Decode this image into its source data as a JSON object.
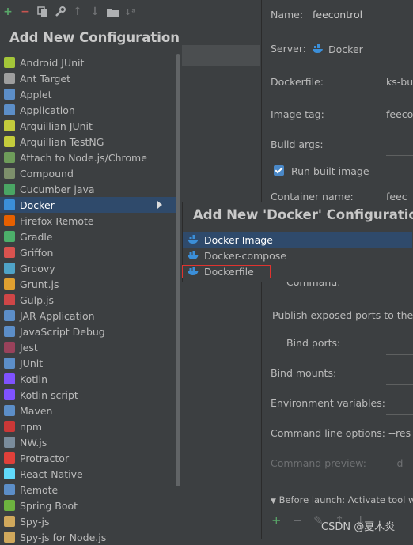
{
  "toolbar": {
    "icons": [
      "add-icon",
      "remove-icon",
      "copy-icon",
      "wrench-icon",
      "move-up-icon",
      "move-down-icon",
      "folder-icon",
      "sort-icon"
    ]
  },
  "left": {
    "title": "Add New Configuration",
    "items": [
      {
        "label": "Android JUnit",
        "icon": "android-junit-icon",
        "color": "#a4c639"
      },
      {
        "label": "Ant Target",
        "icon": "ant-icon",
        "color": "#9e9e9e"
      },
      {
        "label": "Applet",
        "icon": "applet-icon",
        "color": "#5c8ec8"
      },
      {
        "label": "Application",
        "icon": "application-icon",
        "color": "#5c8ec8"
      },
      {
        "label": "Arquillian JUnit",
        "icon": "arquillian-icon",
        "color": "#c4cc3c"
      },
      {
        "label": "Arquillian TestNG",
        "icon": "arquillian-icon",
        "color": "#c4cc3c"
      },
      {
        "label": "Attach to Node.js/Chrome",
        "icon": "nodejs-icon",
        "color": "#6e9c5a"
      },
      {
        "label": "Compound",
        "icon": "compound-icon",
        "color": "#7d8f6b"
      },
      {
        "label": "Cucumber java",
        "icon": "cucumber-icon",
        "color": "#4aa564"
      },
      {
        "label": "Docker",
        "icon": "docker-icon",
        "color": "#3b8fd9",
        "selected": true
      },
      {
        "label": "Firefox Remote",
        "icon": "firefox-icon",
        "color": "#e66000"
      },
      {
        "label": "Gradle",
        "icon": "gradle-icon",
        "color": "#4caf6a"
      },
      {
        "label": "Griffon",
        "icon": "griffon-icon",
        "color": "#d9534f"
      },
      {
        "label": "Groovy",
        "icon": "groovy-icon",
        "color": "#4fa3c7"
      },
      {
        "label": "Grunt.js",
        "icon": "grunt-icon",
        "color": "#e0a030"
      },
      {
        "label": "Gulp.js",
        "icon": "gulp-icon",
        "color": "#cf4647"
      },
      {
        "label": "JAR Application",
        "icon": "jar-icon",
        "color": "#5c8ec8"
      },
      {
        "label": "JavaScript Debug",
        "icon": "js-debug-icon",
        "color": "#5c8ec8"
      },
      {
        "label": "Jest",
        "icon": "jest-icon",
        "color": "#99425b"
      },
      {
        "label": "JUnit",
        "icon": "junit-icon",
        "color": "#5c8ec8"
      },
      {
        "label": "Kotlin",
        "icon": "kotlin-icon",
        "color": "#7f52ff"
      },
      {
        "label": "Kotlin script",
        "icon": "kotlin-script-icon",
        "color": "#7f52ff"
      },
      {
        "label": "Maven",
        "icon": "maven-icon",
        "color": "#5c8ec8"
      },
      {
        "label": "npm",
        "icon": "npm-icon",
        "color": "#cb3837"
      },
      {
        "label": "NW.js",
        "icon": "nwjs-icon",
        "color": "#7a8c9c"
      },
      {
        "label": "Protractor",
        "icon": "protractor-icon",
        "color": "#e0403a"
      },
      {
        "label": "React Native",
        "icon": "react-icon",
        "color": "#61dafb"
      },
      {
        "label": "Remote",
        "icon": "remote-icon",
        "color": "#5c8ec8"
      },
      {
        "label": "Spring Boot",
        "icon": "spring-icon",
        "color": "#6db33f"
      },
      {
        "label": "Spy-js",
        "icon": "spyjs-icon",
        "color": "#d0a85c"
      },
      {
        "label": "Spy-js for Node.js",
        "icon": "spyjs-icon",
        "color": "#d0a85c"
      }
    ]
  },
  "form": {
    "name_label": "Name:",
    "name_value": "feecontrol",
    "server_label": "Server:",
    "server_value": "Docker",
    "dockerfile_label": "Dockerfile:",
    "dockerfile_value": "ks-bu",
    "image_tag_label": "Image tag:",
    "image_tag_value": "feeco",
    "build_args_label": "Build args:",
    "run_built_image_label": "Run built image",
    "container_name_label": "Container name:",
    "container_name_value": "feec",
    "command_label": "Command:",
    "publish_ports_label": "Publish exposed ports to the h",
    "bind_ports_label": "Bind ports:",
    "bind_mounts_label": "Bind mounts:",
    "env_vars_label": "Environment variables:",
    "cmd_options_label": "Command line options:",
    "cmd_options_value": "--res",
    "cmd_preview_label": "Command preview:",
    "cmd_preview_value": "-d",
    "before_launch_label": "Before launch: Activate tool win"
  },
  "popup": {
    "title": "Add New 'Docker' Configuration",
    "items": [
      "Docker Image",
      "Docker-compose",
      "Dockerfile"
    ]
  },
  "watermark": "CSDN @夏木炎"
}
